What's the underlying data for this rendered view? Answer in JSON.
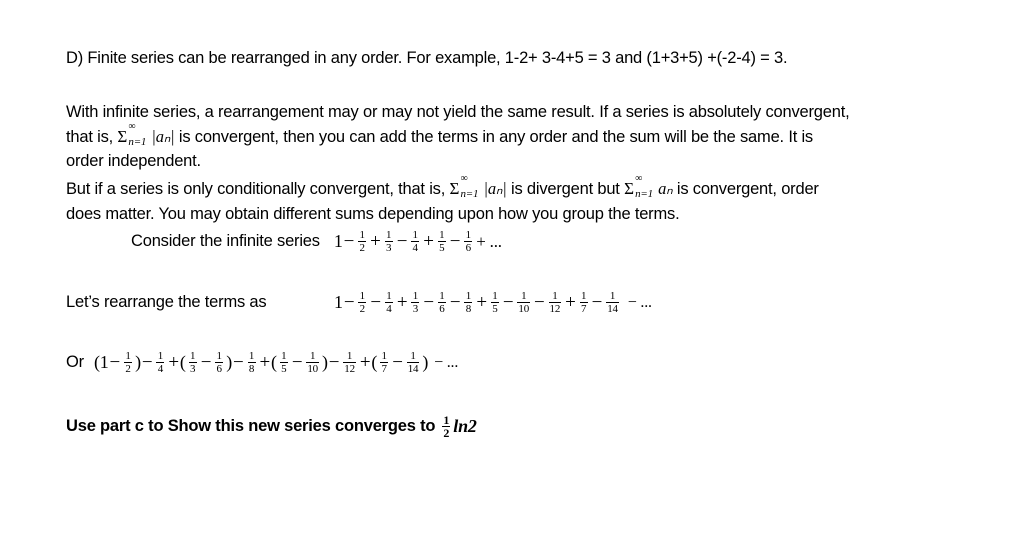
{
  "part_d": {
    "line1": "D) Finite series can be rearranged in any order.  For example,  1-2+ 3-4+5 = 3 and (1+3+5) +(-2-4) = 3."
  },
  "para1": {
    "line1": "With infinite series, a rearrangement may or may not yield the same result.  If a series is absolutely convergent,",
    "line2_pre": "that is, ",
    "line2_post": " is convergent, then you can add the terms in any order and the sum will be the same.  It is",
    "line3": "order independent."
  },
  "para2": {
    "line1_pre": "But if a series is only conditionally convergent, that is, ",
    "line1_mid": " is divergent but ",
    "line1_post": " is convergent, order",
    "line2": "does matter.  You may obtain different sums depending upon how you group the terms."
  },
  "math": {
    "sigma": "Σ",
    "sup": "∞",
    "sub": "n=1",
    "abs_an": "|aₙ|",
    "an": "aₙ"
  },
  "consider": {
    "label": "Consider the infinite series",
    "lead": "1",
    "terms": [
      {
        "op": "−",
        "den": "2"
      },
      {
        "op": "+",
        "den": "3"
      },
      {
        "op": "−",
        "den": "4"
      },
      {
        "op": "+",
        "den": "5"
      },
      {
        "op": "−",
        "den": "6"
      }
    ],
    "tail": "+ ..."
  },
  "rearrange": {
    "label": "Let’s rearrange the terms as",
    "lead": "1",
    "terms": [
      {
        "op": "−",
        "den": "2"
      },
      {
        "op": "−",
        "den": "4"
      },
      {
        "op": "+",
        "den": "3"
      },
      {
        "op": "−",
        "den": "6"
      },
      {
        "op": "−",
        "den": "8"
      },
      {
        "op": "+",
        "den": "5"
      },
      {
        "op": "−",
        "den": "10"
      },
      {
        "op": "−",
        "den": "12"
      },
      {
        "op": "+",
        "den": "7"
      },
      {
        "op": "−",
        "den": "14"
      }
    ],
    "tail": "− ..."
  },
  "grouped": {
    "label": "Or",
    "tail": "− ..."
  },
  "task": {
    "text": "Use part c to Show this new series converges to",
    "frac_num": "1",
    "frac_den": "2",
    "result": "ln2"
  }
}
